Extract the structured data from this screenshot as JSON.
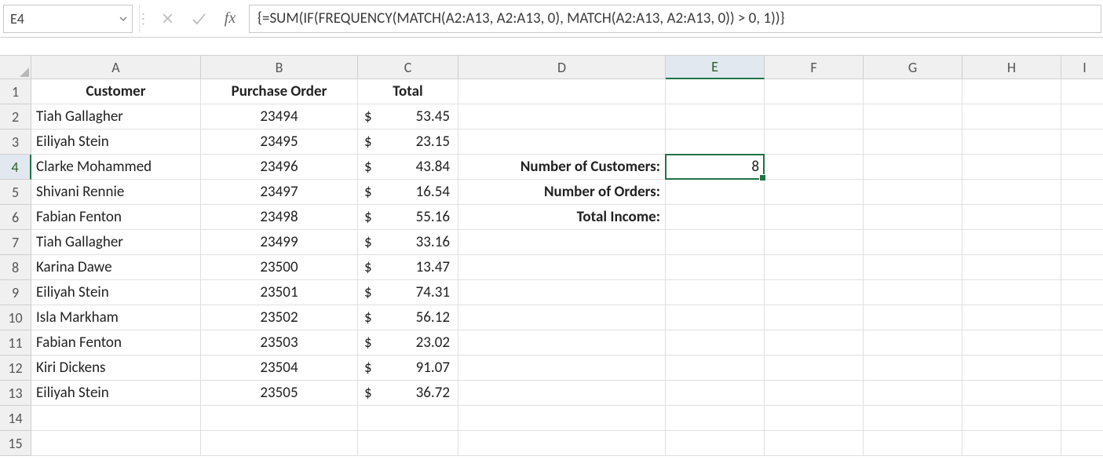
{
  "namebox": {
    "value": "E4"
  },
  "formula_bar": {
    "formula": "{=SUM(IF(FREQUENCY(MATCH(A2:A13, A2:A13, 0), MATCH(A2:A13, A2:A13, 0)) > 0, 1))}",
    "fx_label": "fx"
  },
  "columns": [
    "A",
    "B",
    "C",
    "D",
    "E",
    "F",
    "G",
    "H",
    "I"
  ],
  "row_numbers": [
    "1",
    "2",
    "3",
    "4",
    "5",
    "6",
    "7",
    "8",
    "9",
    "10",
    "11",
    "12",
    "13",
    "14",
    "15"
  ],
  "headers": {
    "A": "Customer",
    "B": "Purchase Order",
    "C": "Total"
  },
  "rows": [
    {
      "customer": "Tiah Gallagher",
      "po": "23494",
      "total": "53.45"
    },
    {
      "customer": "Eiliyah Stein",
      "po": "23495",
      "total": "23.15"
    },
    {
      "customer": "Clarke Mohammed",
      "po": "23496",
      "total": "43.84"
    },
    {
      "customer": "Shivani Rennie",
      "po": "23497",
      "total": "16.54"
    },
    {
      "customer": "Fabian Fenton",
      "po": "23498",
      "total": "55.16"
    },
    {
      "customer": "Tiah Gallagher",
      "po": "23499",
      "total": "33.16"
    },
    {
      "customer": "Karina Dawe",
      "po": "23500",
      "total": "13.47"
    },
    {
      "customer": "Eiliyah Stein",
      "po": "23501",
      "total": "74.31"
    },
    {
      "customer": "Isla Markham",
      "po": "23502",
      "total": "56.12"
    },
    {
      "customer": "Fabian Fenton",
      "po": "23503",
      "total": "23.02"
    },
    {
      "customer": "Kiri Dickens",
      "po": "23504",
      "total": "91.07"
    },
    {
      "customer": "Eiliyah Stein",
      "po": "23505",
      "total": "36.72"
    }
  ],
  "labels_D": {
    "4": "Number of Customers:",
    "5": "Number of Orders:",
    "6": "Total Income:"
  },
  "E4_value": "8",
  "currency_symbol": "$",
  "active": {
    "col": "E",
    "row": 4
  }
}
